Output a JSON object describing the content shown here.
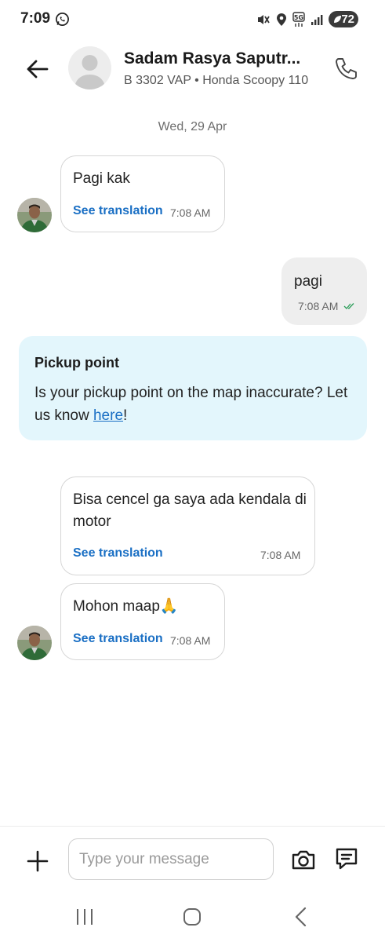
{
  "status_bar": {
    "time": "7:09",
    "battery": "72",
    "network": "5G"
  },
  "header": {
    "driver_name": "Sadam Rasya Saputr...",
    "vehicle_info": "B 3302 VAP • Honda Scoopy 110"
  },
  "date_separator": "Wed, 29 Apr",
  "messages": [
    {
      "direction": "incoming",
      "text": "Pagi kak",
      "action": "See translation",
      "time": "7:08 AM"
    },
    {
      "direction": "outgoing",
      "text": "pagi",
      "time": "7:08 AM",
      "status": "read"
    },
    {
      "direction": "incoming",
      "text": "Bisa cencel ga saya ada kendala di motor",
      "action": "See translation",
      "time": "7:08 AM"
    },
    {
      "direction": "incoming",
      "text": "Mohon maap🙏",
      "action": "See translation",
      "time": "7:08 AM"
    }
  ],
  "pickup_card": {
    "title": "Pickup point",
    "body_before": "Is your pickup point on the map inaccurate? Let us know ",
    "link_text": "here",
    "body_after": "!"
  },
  "composer": {
    "placeholder": "Type your message"
  },
  "icons": {
    "back": "arrow-left-icon",
    "call": "phone-icon",
    "add": "plus-icon",
    "camera": "camera-icon",
    "template": "chat-template-icon"
  },
  "colors": {
    "link": "#1a6fc4",
    "card_bg": "#e3f6fc",
    "outgoing_bubble": "#eeeeee",
    "read_tick": "#2e9e5b"
  }
}
